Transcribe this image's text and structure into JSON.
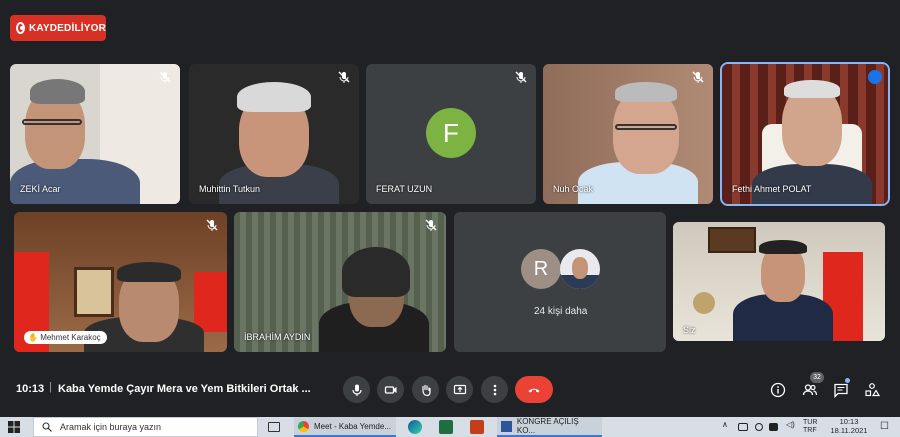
{
  "recording_label": "KAYDEDİLİYOR",
  "participants": [
    {
      "name": "ZEKİ Acar"
    },
    {
      "name": "Muhittin Tutkun"
    },
    {
      "name": "FERAT UZUN",
      "initial": "F"
    },
    {
      "name": "Nuh Ocak"
    },
    {
      "name": "Fethi Ahmet POLAT"
    },
    {
      "name": "Mehmet Karakoç"
    },
    {
      "name": "İBRAHİM AYDIN"
    },
    {
      "name": "Siz"
    }
  ],
  "others": {
    "initial": "R",
    "label": "24 kişi daha"
  },
  "meeting": {
    "time": "10:13",
    "separator": "|",
    "title": "Kaba Yemde Çayır Mera ve Yem Bitkileri Ortak ..."
  },
  "people_count": "32",
  "taskbar": {
    "search_placeholder": "Aramak için buraya yazın",
    "apps": [
      {
        "label": "Meet - Kaba Yemde..."
      },
      {
        "label": "KONGRE AÇILIŞ KO..."
      }
    ],
    "lang": "TUR\nTRF",
    "clock_time": "10:13",
    "clock_date": "18.11.2021"
  },
  "colors": {
    "record": "#d93025",
    "end_call": "#ea4335",
    "active_outline": "#8ab4f8",
    "avatar_f": "#7cb342"
  }
}
